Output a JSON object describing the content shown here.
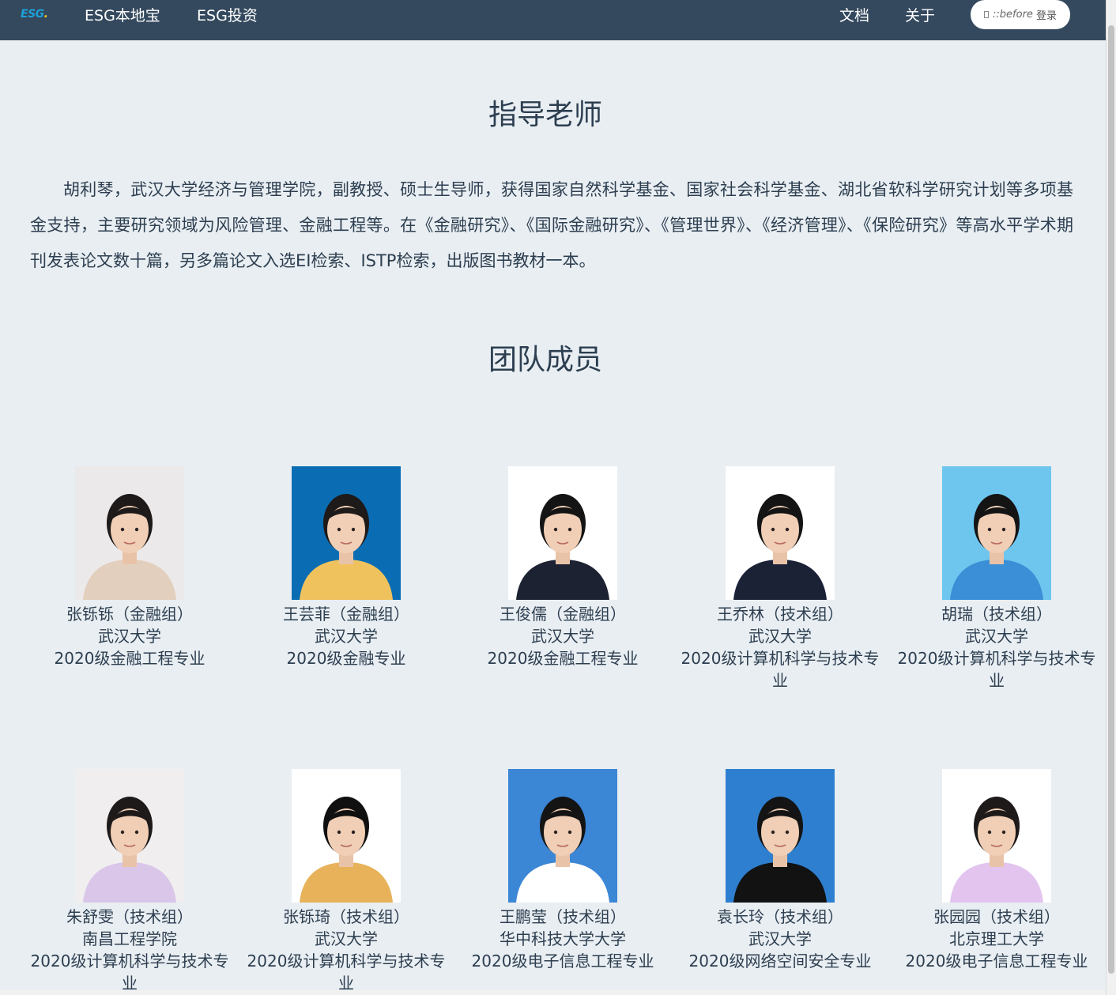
{
  "nav": {
    "logo_main": "ESG",
    "logo_dot": ".",
    "links": [
      "ESG本地宝",
      "ESG投资"
    ],
    "right_links": [
      "文档",
      "关于"
    ],
    "login_before": "::before",
    "login_label": "登录"
  },
  "teacher": {
    "title": "指导老师",
    "description": "胡利琴，武汉大学经济与管理学院，副教授、硕士生导师，获得国家自然科学基金、国家社会科学基金、湖北省软科学研究计划等多项基金支持，主要研究领域为风险管理、金融工程等。在《金融研究》、《国际金融研究》、《管理世界》、《经济管理》、《保险研究》等高水平学术期刊发表论文数十篇，另多篇论文入选EI检索、ISTP检索，出版图书教材一本。"
  },
  "team": {
    "title": "团队成员",
    "members": [
      {
        "name": "张铄铄（金融组）",
        "school": "武汉大学",
        "major": "2020级金融工程专业",
        "bg": "#ece9ea",
        "shirt": "#e3cfbd",
        "hair": "#1e1a1a"
      },
      {
        "name": "王芸菲（金融组）",
        "school": "武汉大学",
        "major": "2020级金融专业",
        "bg": "#0a6db3",
        "shirt": "#f0c25e",
        "hair": "#1e1a1a"
      },
      {
        "name": "王俊儒（金融组）",
        "school": "武汉大学",
        "major": "2020级金融工程专业",
        "bg": "#ffffff",
        "shirt": "#1d2233",
        "hair": "#141414"
      },
      {
        "name": "王乔林（技术组）",
        "school": "武汉大学",
        "major": "2020级计算机科学与技术专业",
        "bg": "#ffffff",
        "shirt": "#1b2236",
        "hair": "#141414"
      },
      {
        "name": "胡瑞（技术组）",
        "school": "武汉大学",
        "major": "2020级计算机科学与技术专业",
        "bg": "#6ec6ef",
        "shirt": "#3a8fd6",
        "hair": "#141414"
      },
      {
        "name": "朱舒雯（技术组）",
        "school": "南昌工程学院",
        "major": "2020级计算机科学与技术专业",
        "bg": "#f1eeef",
        "shirt": "#d9c6e8",
        "hair": "#1e1a1a"
      },
      {
        "name": "张铄琦（技术组）",
        "school": "武汉大学",
        "major": "2020级计算机科学与技术专业",
        "bg": "#ffffff",
        "shirt": "#e8b25a",
        "hair": "#101010"
      },
      {
        "name": "王鹏莹（技术组）",
        "school": "华中科技大学大学",
        "major": "2020级电子信息工程专业",
        "bg": "#3c86d6",
        "shirt": "#ffffff",
        "hair": "#141414"
      },
      {
        "name": "袁长玲（技术组）",
        "school": "武汉大学",
        "major": "2020级网络空间安全专业",
        "bg": "#2f7fd0",
        "shirt": "#121212",
        "hair": "#141414"
      },
      {
        "name": "张园园（技术组）",
        "school": "北京理工大学",
        "major": "2020级电子信息工程专业",
        "bg": "#ffffff",
        "shirt": "#e2c4ee",
        "hair": "#1e1a1a"
      }
    ]
  }
}
